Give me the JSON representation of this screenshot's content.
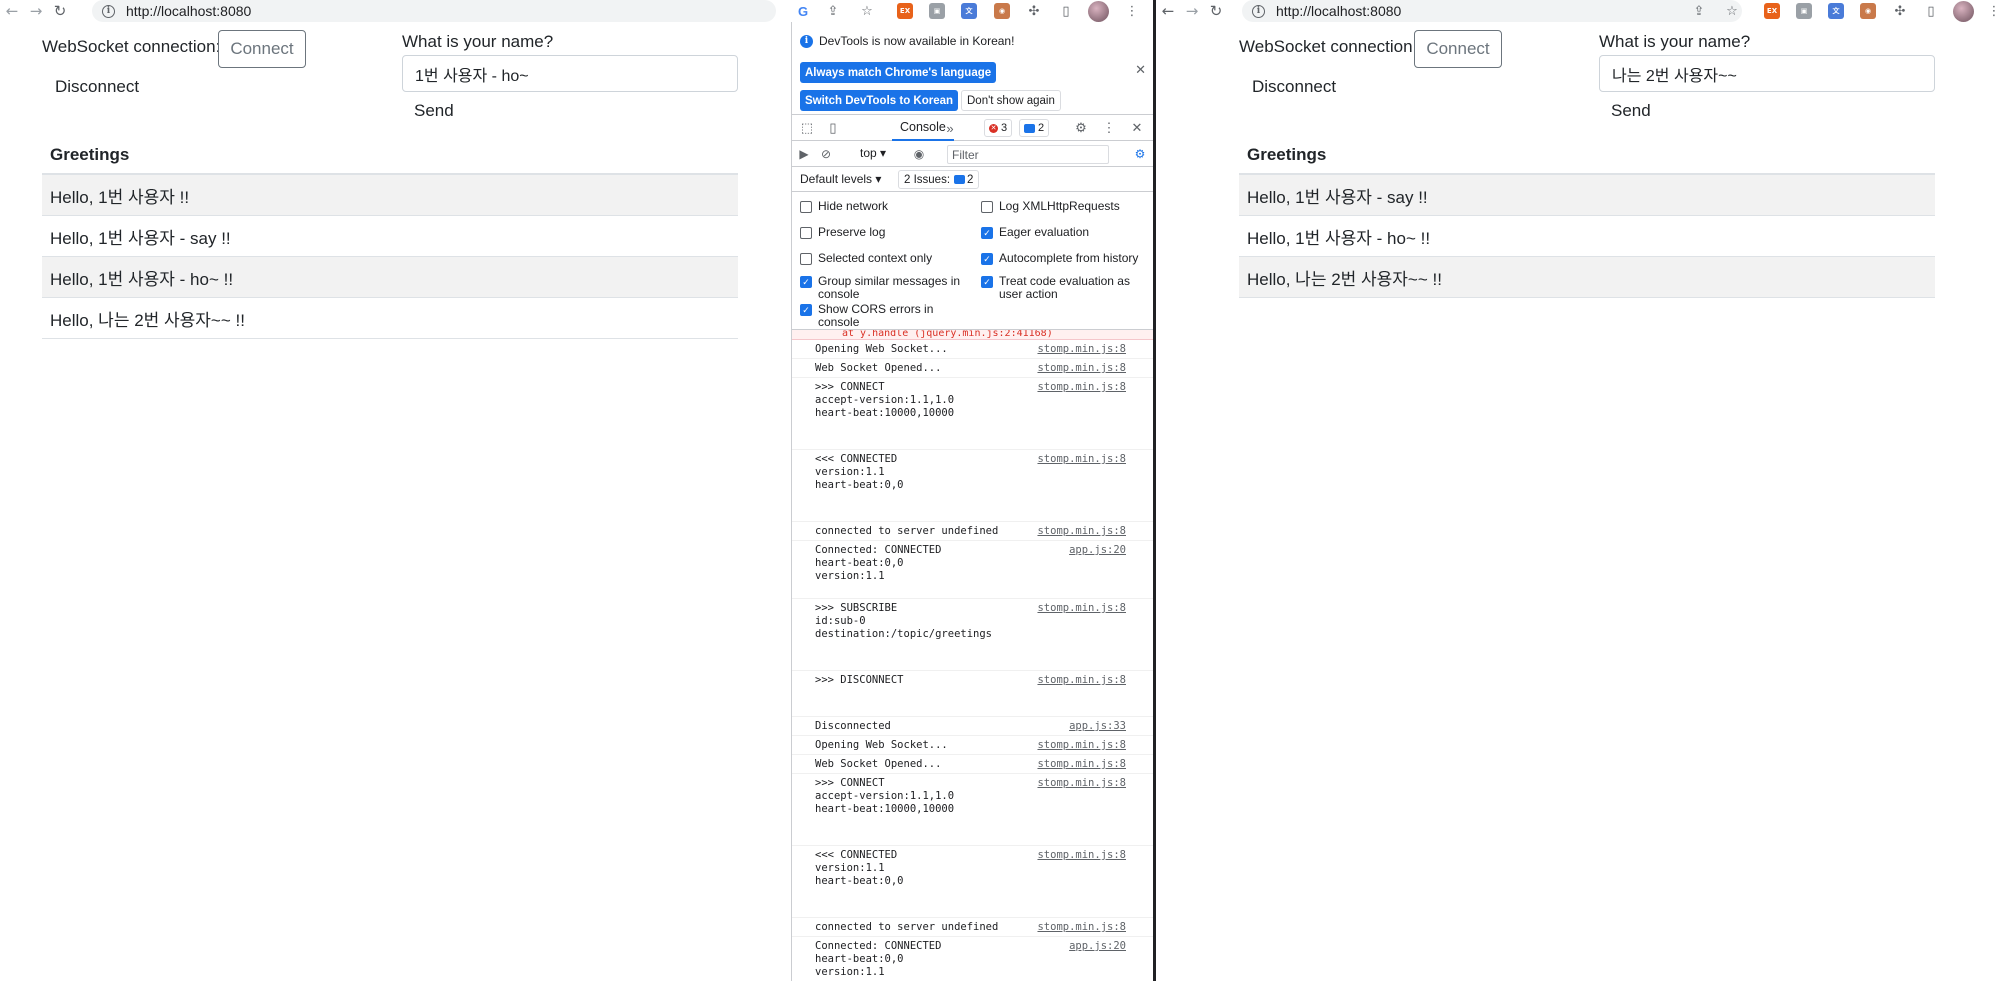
{
  "left_window": {
    "url": "http://localhost:8080",
    "page": {
      "ws_label": "WebSocket connection:",
      "connect_label": "Connect",
      "disconnect_label": "Disconnect",
      "name_label": "What is your name?",
      "name_value": "1번 사용자 - ho~",
      "send_label": "Send",
      "greetings_header": "Greetings",
      "greetings": [
        "Hello, 1번 사용자 !!",
        "Hello, 1번 사용자 - say !!",
        "Hello, 1번 사용자 - ho~ !!",
        "Hello, 나는 2번 사용자~~ !!"
      ]
    },
    "devtools": {
      "banner_message": "DevTools is now available in Korean!",
      "always_match_label": "Always match Chrome's language",
      "switch_label": "Switch DevTools to Korean",
      "dont_show_label": "Don't show again",
      "console_tab": "Console",
      "error_count": "3",
      "message_count": "2",
      "context": "top ▾",
      "filter_placeholder": "Filter",
      "default_levels": "Default levels ▾",
      "issues_label": "2 Issues:",
      "issues_count": "2",
      "settings": [
        {
          "label": "Hide network",
          "checked": false
        },
        {
          "label": "Log XMLHttpRequests",
          "checked": false
        },
        {
          "label": "Preserve log",
          "checked": false
        },
        {
          "label": "Eager evaluation",
          "checked": true
        },
        {
          "label": "Selected context only",
          "checked": false
        },
        {
          "label": "Autocomplete from history",
          "checked": true
        },
        {
          "label": "Group similar messages in console",
          "checked": true
        },
        {
          "label": "Treat code evaluation as user action",
          "checked": true
        },
        {
          "label": "Show CORS errors in console",
          "checked": true
        }
      ],
      "error_line": "at y.handle (jquery.min.js:2:41168)",
      "log": [
        {
          "text": "Opening Web Socket...",
          "src": "stomp.min.js:8"
        },
        {
          "text": "Web Socket Opened...",
          "src": "stomp.min.js:8"
        },
        {
          "text": ">>> CONNECT\naccept-version:1.1,1.0\nheart-beat:10000,10000\n\n\n",
          "src": "stomp.min.js:8"
        },
        {
          "text": "<<< CONNECTED\nversion:1.1\nheart-beat:0,0\n\n\n",
          "src": "stomp.min.js:8"
        },
        {
          "text": "connected to server undefined",
          "src": "stomp.min.js:8"
        },
        {
          "text": "Connected: CONNECTED\nheart-beat:0,0\nversion:1.1\n",
          "src": "app.js:20"
        },
        {
          "text": ">>> SUBSCRIBE\nid:sub-0\ndestination:/topic/greetings\n\n\n",
          "src": "stomp.min.js:8"
        },
        {
          "text": ">>> DISCONNECT\n\n\n",
          "src": "stomp.min.js:8"
        },
        {
          "text": "Disconnected",
          "src": "app.js:33"
        },
        {
          "text": "Opening Web Socket...",
          "src": "stomp.min.js:8"
        },
        {
          "text": "Web Socket Opened...",
          "src": "stomp.min.js:8"
        },
        {
          "text": ">>> CONNECT\naccept-version:1.1,1.0\nheart-beat:10000,10000\n\n\n",
          "src": "stomp.min.js:8"
        },
        {
          "text": "<<< CONNECTED\nversion:1.1\nheart-beat:0,0\n\n\n",
          "src": "stomp.min.js:8"
        },
        {
          "text": "connected to server undefined",
          "src": "stomp.min.js:8"
        },
        {
          "text": "Connected: CONNECTED\nheart-beat:0,0\nversion:1.1",
          "src": "app.js:20"
        }
      ]
    }
  },
  "right_window": {
    "url": "http://localhost:8080",
    "page": {
      "ws_label": "WebSocket connection:",
      "connect_label": "Connect",
      "disconnect_label": "Disconnect",
      "name_label": "What is your name?",
      "name_value": "나는 2번 사용자~~",
      "send_label": "Send",
      "greetings_header": "Greetings",
      "greetings": [
        "Hello, 1번 사용자 - say !!",
        "Hello, 1번 사용자 - ho~ !!",
        "Hello, 나는 2번 사용자~~ !!"
      ]
    }
  },
  "colors": {
    "accent": "#1a73e8",
    "error": "#d93025",
    "stripe": "#f2f2f2"
  },
  "icons": [
    "back-arrow-icon",
    "forward-arrow-icon",
    "reload-icon",
    "info-icon",
    "google-icon",
    "share-icon",
    "star-icon",
    "puzzle-icon",
    "side-panel-icon",
    "kebab-menu-icon"
  ]
}
